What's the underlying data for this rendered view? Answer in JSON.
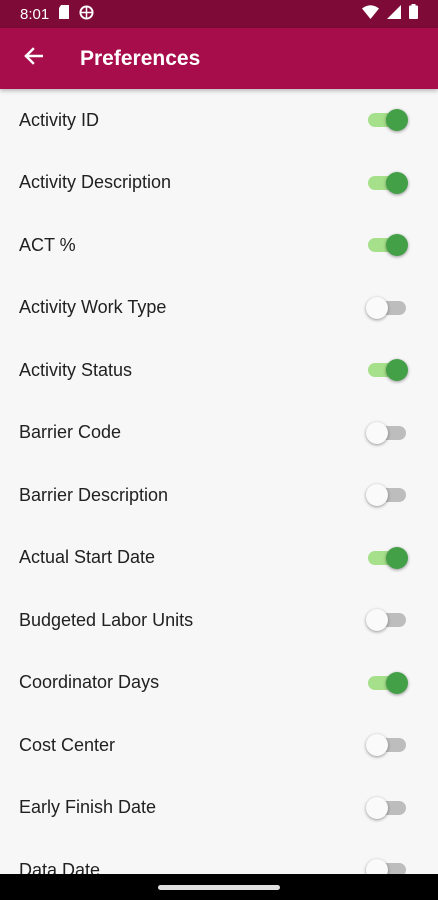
{
  "status_bar": {
    "time": "8:01",
    "icons": [
      "sd-card-icon",
      "vpn-globe-icon",
      "wifi-icon",
      "signal-icon",
      "battery-icon"
    ],
    "bg_color": "#7d0a37"
  },
  "app_bar": {
    "title": "Preferences",
    "back_icon": "arrow-left-icon",
    "bg_color": "#a80d4b"
  },
  "preferences": [
    {
      "label": "Activity ID",
      "on": true
    },
    {
      "label": "Activity Description",
      "on": true
    },
    {
      "label": "ACT %",
      "on": true
    },
    {
      "label": "Activity Work Type",
      "on": false
    },
    {
      "label": "Activity Status",
      "on": true
    },
    {
      "label": "Barrier Code",
      "on": false
    },
    {
      "label": "Barrier Description",
      "on": false
    },
    {
      "label": "Actual Start Date",
      "on": true
    },
    {
      "label": "Budgeted Labor Units",
      "on": false
    },
    {
      "label": "Coordinator Days",
      "on": true
    },
    {
      "label": "Cost Center",
      "on": false
    },
    {
      "label": "Early Finish Date",
      "on": false
    },
    {
      "label": "Data Date",
      "on": false
    }
  ],
  "colors": {
    "switch_on_thumb": "#43a047",
    "switch_on_track": "#a6e08a",
    "switch_off_thumb": "#fafafa",
    "switch_off_track": "#bdbdbd"
  }
}
